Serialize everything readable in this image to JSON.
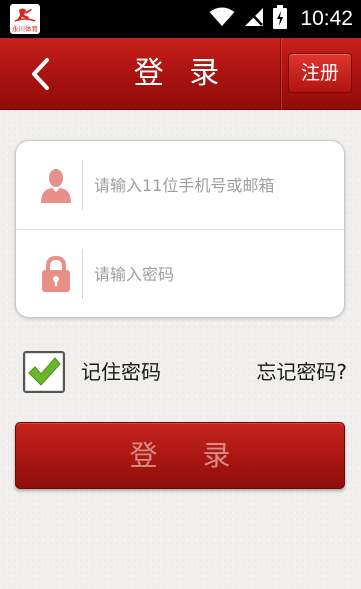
{
  "status_bar": {
    "time": "10:42",
    "logo_text": "永川体育",
    "icons": [
      "wifi-icon",
      "signal-icon",
      "battery-icon"
    ]
  },
  "header": {
    "title": "登 录",
    "back_icon": "chevron-left-icon",
    "register_label": "注册"
  },
  "form": {
    "username": {
      "placeholder": "请输入11位手机号或邮箱",
      "value": "",
      "icon": "user-icon"
    },
    "password": {
      "placeholder": "请输入密码",
      "value": "",
      "icon": "lock-icon"
    },
    "remember": {
      "label": "记住密码",
      "checked": true
    },
    "forgot_label": "忘记密码?",
    "submit_label": "登 录"
  },
  "colors": {
    "brand_red": "#b0140f",
    "icon_pink": "#e89088",
    "check_green": "#6ab82a"
  }
}
